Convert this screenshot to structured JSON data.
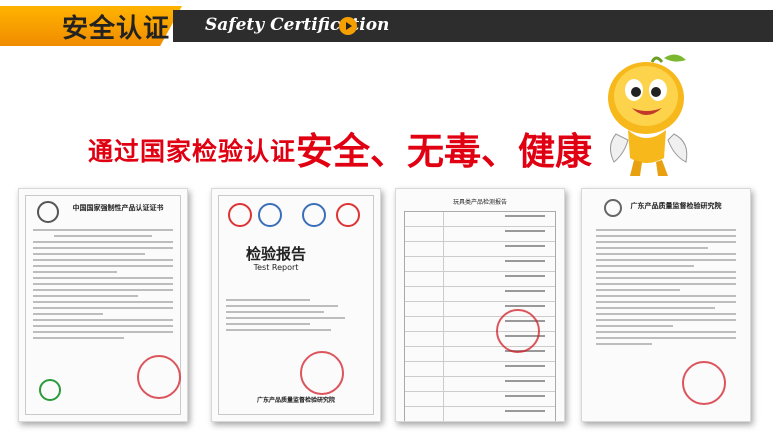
{
  "header": {
    "title_cn": "安全认证",
    "title_en": "Safety Certification",
    "arrow_icon": "arrow-right-icon",
    "accent_color": "#f5a000",
    "bar_color": "#2d2d2d"
  },
  "slogan": {
    "small": "通过国家检验认证",
    "big": "安全、无毒、健康",
    "color": "#e00012"
  },
  "certificates": [
    {
      "title": "中国国家强制性产品认证证书",
      "footer": "CCC"
    },
    {
      "title_cn": "检验报告",
      "title_en": "Test Report",
      "org": "广东产品质量监督检验研究院"
    },
    {
      "title": "玩具类产品检测报告"
    },
    {
      "title": "广东产品质量监督检验研究院"
    }
  ]
}
